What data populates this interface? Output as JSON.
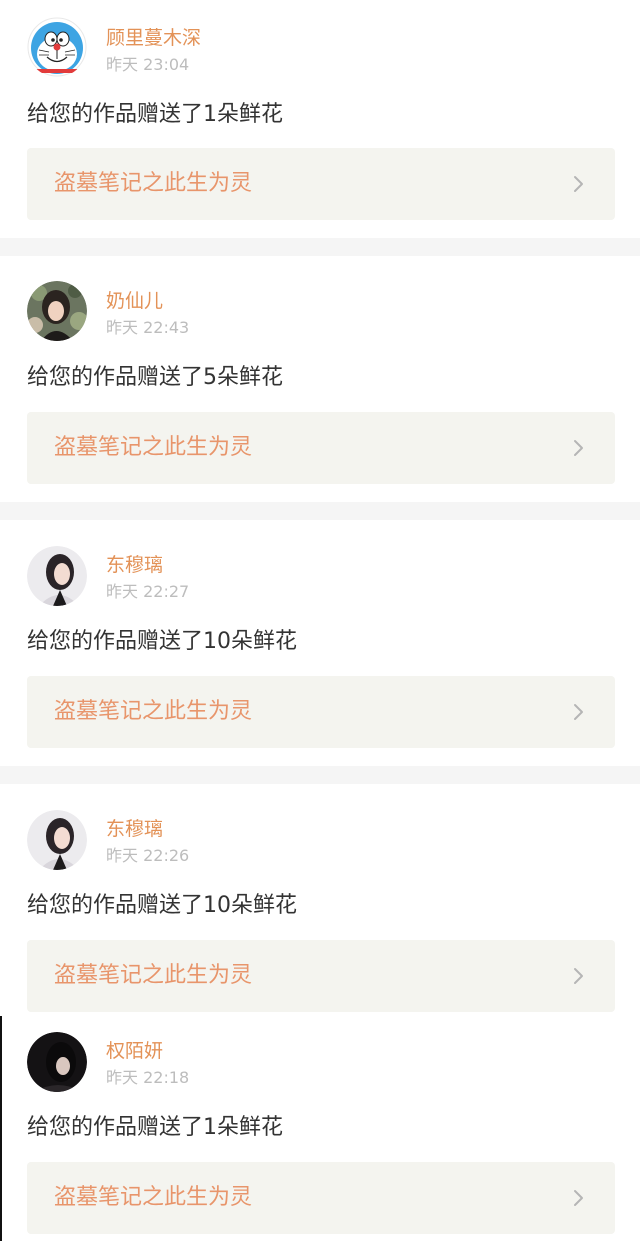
{
  "colors": {
    "name": "#e39257",
    "time": "#bdbdbd",
    "message": "#333333",
    "work_bg": "#f4f4ef",
    "work_title": "#e8956b",
    "separator": "#f5f5f5"
  },
  "notifications": [
    {
      "user": "顾里蔓木深",
      "time": "昨天 23:04",
      "message": "给您的作品赠送了1朵鲜花",
      "work_title": "盗墓笔记之此生为灵",
      "avatar_icon": "doraemon-avatar"
    },
    {
      "user": "奶仙儿",
      "time": "昨天 22:43",
      "message": "给您的作品赠送了5朵鲜花",
      "work_title": "盗墓笔记之此生为灵",
      "avatar_icon": "user-photo-avatar"
    },
    {
      "user": "东穆璃",
      "time": "昨天 22:27",
      "message": "给您的作品赠送了10朵鲜花",
      "work_title": "盗墓笔记之此生为灵",
      "avatar_icon": "user-photo-avatar"
    },
    {
      "user": "东穆璃",
      "time": "昨天 22:26",
      "message": "给您的作品赠送了10朵鲜花",
      "work_title": "盗墓笔记之此生为灵",
      "avatar_icon": "user-photo-avatar"
    },
    {
      "user": "权陌妍",
      "time": "昨天 22:18",
      "message": "给您的作品赠送了1朵鲜花",
      "work_title": "盗墓笔记之此生为灵",
      "avatar_icon": "user-photo-avatar"
    }
  ]
}
